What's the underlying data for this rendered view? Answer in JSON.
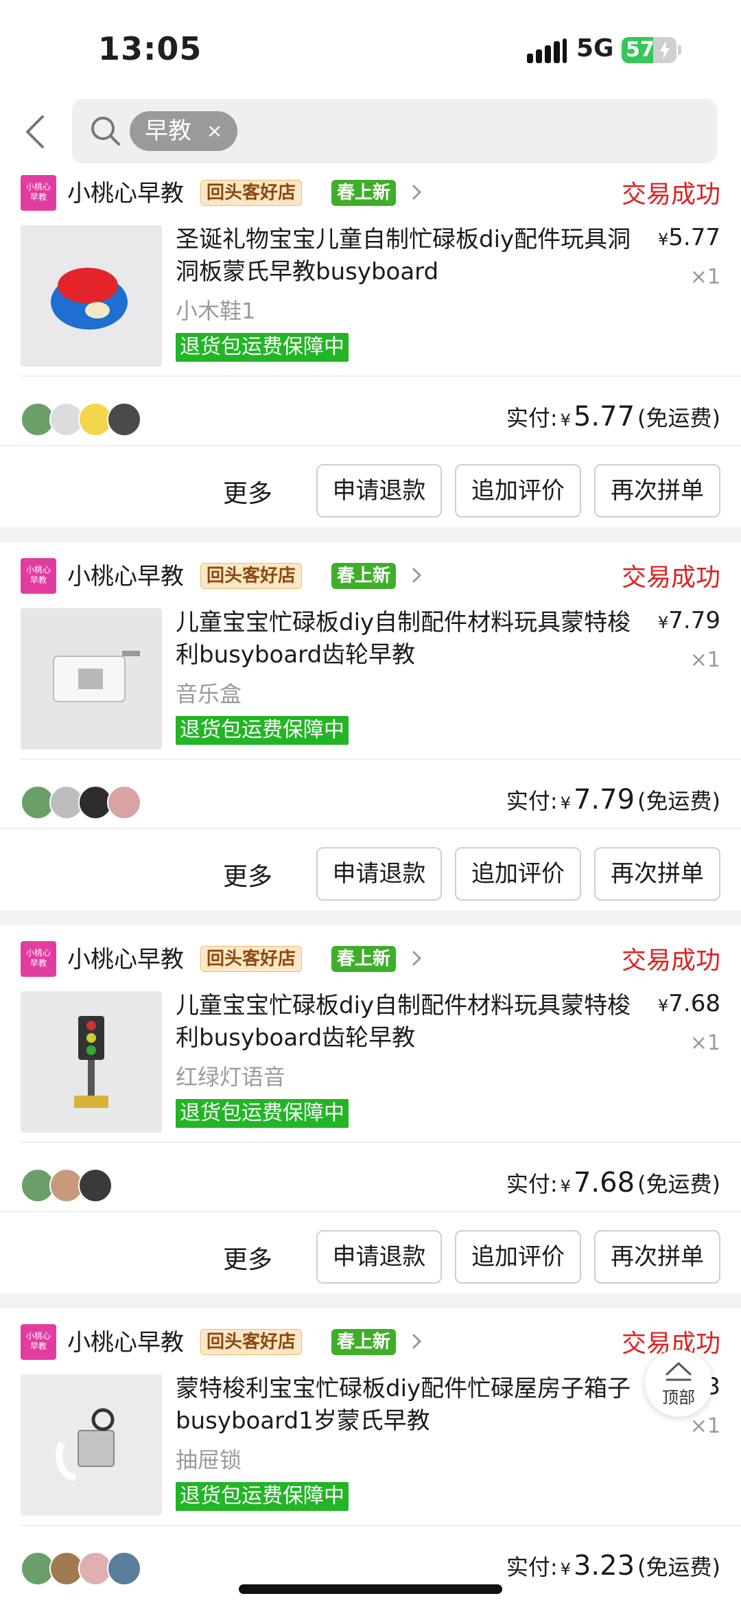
{
  "status_bar": {
    "time": "13:05",
    "network": "5G",
    "battery": "57",
    "battery_level": 0.57
  },
  "search": {
    "chip_text": "早教",
    "chip_close": "×"
  },
  "orders": [
    {
      "shop_logo": "小桃心\n早教",
      "shop_name": "小桃心早教",
      "badge_return": "回头客好店",
      "badge_spring": "春上新",
      "status": "交易成功",
      "title": "圣诞礼物宝宝儿童自制忙碌板diy配件玩具洞洞板蒙氏早教busyboard",
      "price": "5.77",
      "qty": "×1",
      "sku": "小木鞋1",
      "guarantee": "退货包运费保障中",
      "paid_label": "实付:",
      "paid_amount": "5.77",
      "shipping": "(免运费)",
      "more": "更多",
      "btn_refund": "申请退款",
      "btn_review": "追加评价",
      "btn_reorder": "再次拼单",
      "currency": "¥"
    },
    {
      "shop_logo": "小桃心\n早教",
      "shop_name": "小桃心早教",
      "badge_return": "回头客好店",
      "badge_spring": "春上新",
      "status": "交易成功",
      "title": "儿童宝宝忙碌板diy自制配件材料玩具蒙特梭利busyboard齿轮早教",
      "price": "7.79",
      "qty": "×1",
      "sku": "音乐盒",
      "guarantee": "退货包运费保障中",
      "paid_label": "实付:",
      "paid_amount": "7.79",
      "shipping": "(免运费)",
      "more": "更多",
      "btn_refund": "申请退款",
      "btn_review": "追加评价",
      "btn_reorder": "再次拼单",
      "currency": "¥"
    },
    {
      "shop_logo": "小桃心\n早教",
      "shop_name": "小桃心早教",
      "badge_return": "回头客好店",
      "badge_spring": "春上新",
      "status": "交易成功",
      "title": "儿童宝宝忙碌板diy自制配件材料玩具蒙特梭利busyboard齿轮早教",
      "price": "7.68",
      "qty": "×1",
      "sku": "红绿灯语音",
      "guarantee": "退货包运费保障中",
      "paid_label": "实付:",
      "paid_amount": "7.68",
      "shipping": "(免运费)",
      "more": "更多",
      "btn_refund": "申请退款",
      "btn_review": "追加评价",
      "btn_reorder": "再次拼单",
      "currency": "¥"
    },
    {
      "shop_logo": "小桃心\n早教",
      "shop_name": "小桃心早教",
      "badge_return": "回头客好店",
      "badge_spring": "春上新",
      "status": "交易成功",
      "title": "蒙特梭利宝宝忙碌板diy配件忙碌屋房子箱子busyboard1岁蒙氏早教",
      "price": "3.23",
      "qty": "×1",
      "sku": "抽屉锁",
      "guarantee": "退货包运费保障中",
      "paid_label": "实付:",
      "paid_amount": "3.23",
      "shipping": "(免运费)",
      "currency": "¥"
    }
  ],
  "top_button": "顶部",
  "colors": {
    "status_red": "#e02020",
    "guarantee_green": "#22b526",
    "spring_green": "#3fae29",
    "shop_pink": "#e23ca0"
  }
}
